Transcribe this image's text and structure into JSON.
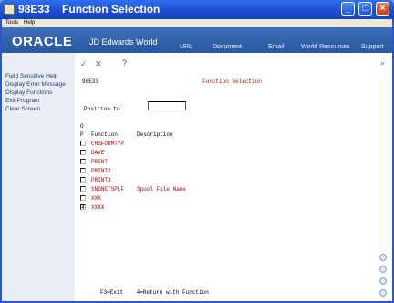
{
  "window": {
    "title": "98E33    Function Selection",
    "minimize": "_",
    "maximize": "□",
    "close": "×"
  },
  "menubar": {
    "tools": "Tools",
    "help": "Help"
  },
  "banner": {
    "logo": "ORACLE",
    "product": "JD Edwards World",
    "links": [
      "URL",
      "Document",
      "Email",
      "World Resources",
      "Support"
    ]
  },
  "sidebar": {
    "items": [
      "Field Sensitive Help",
      "Display Error Message",
      "Display Functions",
      "Exit Program",
      "Clear Screen"
    ]
  },
  "toolbar": {
    "ok_icon": "✓",
    "cancel_icon": "✕",
    "help_icon": "?",
    "search_icon": "⌕"
  },
  "form": {
    "program": "98E33",
    "title": "Function Selection",
    "position_label": "Position to",
    "position_value": "",
    "col_option_top": "O",
    "col_option_bottom": "P",
    "col_function": "Function",
    "col_description": "Description"
  },
  "rows": [
    {
      "option": "",
      "function": "CHGFORMTYP",
      "description": ""
    },
    {
      "option": "",
      "function": "DAVE",
      "description": ""
    },
    {
      "option": "",
      "function": "PRINT",
      "description": ""
    },
    {
      "option": "",
      "function": "PRINT2",
      "description": ""
    },
    {
      "option": "",
      "function": "PRINT3",
      "description": ""
    },
    {
      "option": "",
      "function": "SNDNETSPLF",
      "description": "Spool File Name"
    },
    {
      "option": "",
      "function": "XXX",
      "description": ""
    },
    {
      "option": "4",
      "function": "XXXX",
      "description": ""
    }
  ],
  "footer": "F3=Exit    4=Return with Function"
}
